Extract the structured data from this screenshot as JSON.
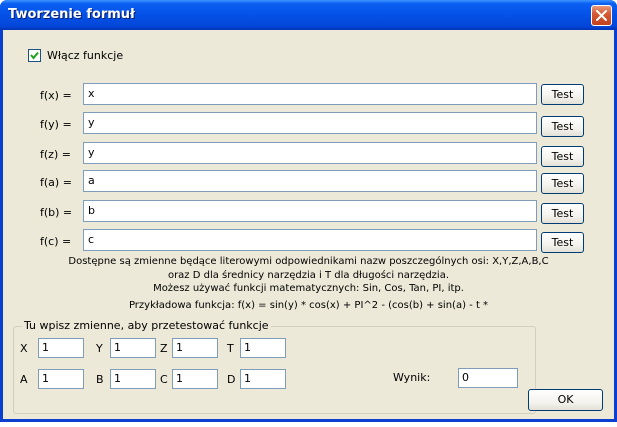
{
  "window": {
    "title": "Tworzenie formuł"
  },
  "enable": {
    "label": "Włącz funkcje",
    "checked": true
  },
  "functions": [
    {
      "label": "f(x) =",
      "value": "x",
      "button": "Test"
    },
    {
      "label": "f(y) =",
      "value": "y",
      "button": "Test"
    },
    {
      "label": "f(z) =",
      "value": "y",
      "button": "Test"
    },
    {
      "label": "f(a) =",
      "value": "a",
      "button": "Test"
    },
    {
      "label": "f(b) =",
      "value": "b",
      "button": "Test"
    },
    {
      "label": "f(c) =",
      "value": "c",
      "button": "Test"
    }
  ],
  "info": {
    "line1": "Dostępne są zmienne będące literowymi odpowiednikami nazw poszczególnych osi: X,Y,Z,A,B,C",
    "line2": "oraz D dla średnicy narzędzia i T dla długości narzędzia.",
    "line3": "Możesz używać funkcji matematycznych: Sin, Cos, Tan, PI, itp.",
    "example_label": "Przykładowa funkcja: f(x) =",
    "example_formula": "sin(y) * cos(x) + PI^2 - (cos(b) + sin(a) - t *"
  },
  "test_group": {
    "title": "Tu wpisz zmienne, aby przetestować funkcje",
    "vars": [
      {
        "label": "X",
        "value": "1"
      },
      {
        "label": "Y",
        "value": "1"
      },
      {
        "label": "Z",
        "value": "1"
      },
      {
        "label": "T",
        "value": "1"
      },
      {
        "label": "A",
        "value": "1"
      },
      {
        "label": "B",
        "value": "1"
      },
      {
        "label": "C",
        "value": "1"
      },
      {
        "label": "D",
        "value": "1"
      }
    ]
  },
  "result": {
    "label": "Wynik:",
    "value": "0"
  },
  "ok_button": "OK",
  "colors": {
    "title_bar": "#0551e7",
    "dialog_bg": "#ece9d8",
    "close_button": "#d75a34",
    "input_border": "#7f9db9"
  }
}
